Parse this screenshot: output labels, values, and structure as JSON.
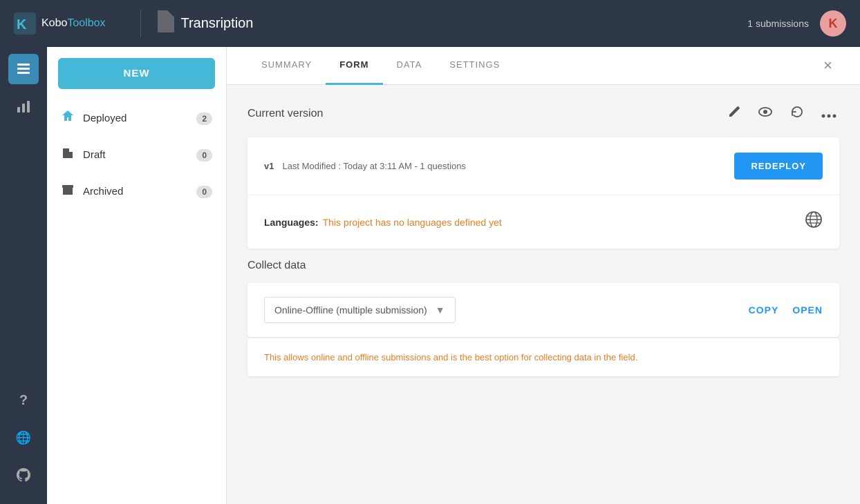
{
  "header": {
    "logo_kobo": "Kobo",
    "logo_toolbox": "Toolbox",
    "project_title": "Transription",
    "submissions_count": "1 submissions",
    "avatar_letter": "K"
  },
  "sidebar": {
    "new_button_label": "NEW",
    "items": [
      {
        "id": "deployed",
        "label": "Deployed",
        "badge": "2",
        "icon": "deploy"
      },
      {
        "id": "draft",
        "label": "Draft",
        "badge": "0",
        "icon": "draft"
      },
      {
        "id": "archived",
        "label": "Archived",
        "badge": "0",
        "icon": "archive"
      }
    ]
  },
  "tabs": {
    "items": [
      {
        "id": "summary",
        "label": "SUMMARY"
      },
      {
        "id": "form",
        "label": "FORM"
      },
      {
        "id": "data",
        "label": "DATA"
      },
      {
        "id": "settings",
        "label": "SETTINGS"
      }
    ],
    "active": "form",
    "close_label": "×"
  },
  "form_panel": {
    "current_version_label": "Current version",
    "version_badge": "v1",
    "version_info": "Last Modified : Today at 3:11 AM - 1 questions",
    "redeploy_label": "REDEPLOY",
    "languages_label": "Languages:",
    "languages_value": "This project has no languages defined yet",
    "collect_data_label": "Collect data",
    "dropdown_value": "Online-Offline (multiple submission)",
    "copy_label": "COPY",
    "open_label": "OPEN",
    "collect_info": "This allows online and offline submissions and is the best option for collecting data in the field."
  },
  "iconbar": {
    "items": [
      {
        "id": "list",
        "icon": "list",
        "active": true
      },
      {
        "id": "chart",
        "icon": "chart",
        "active": false
      }
    ],
    "bottom_items": [
      {
        "id": "help",
        "icon": "?"
      },
      {
        "id": "globe",
        "icon": "🌐"
      },
      {
        "id": "github",
        "icon": "github"
      }
    ]
  }
}
